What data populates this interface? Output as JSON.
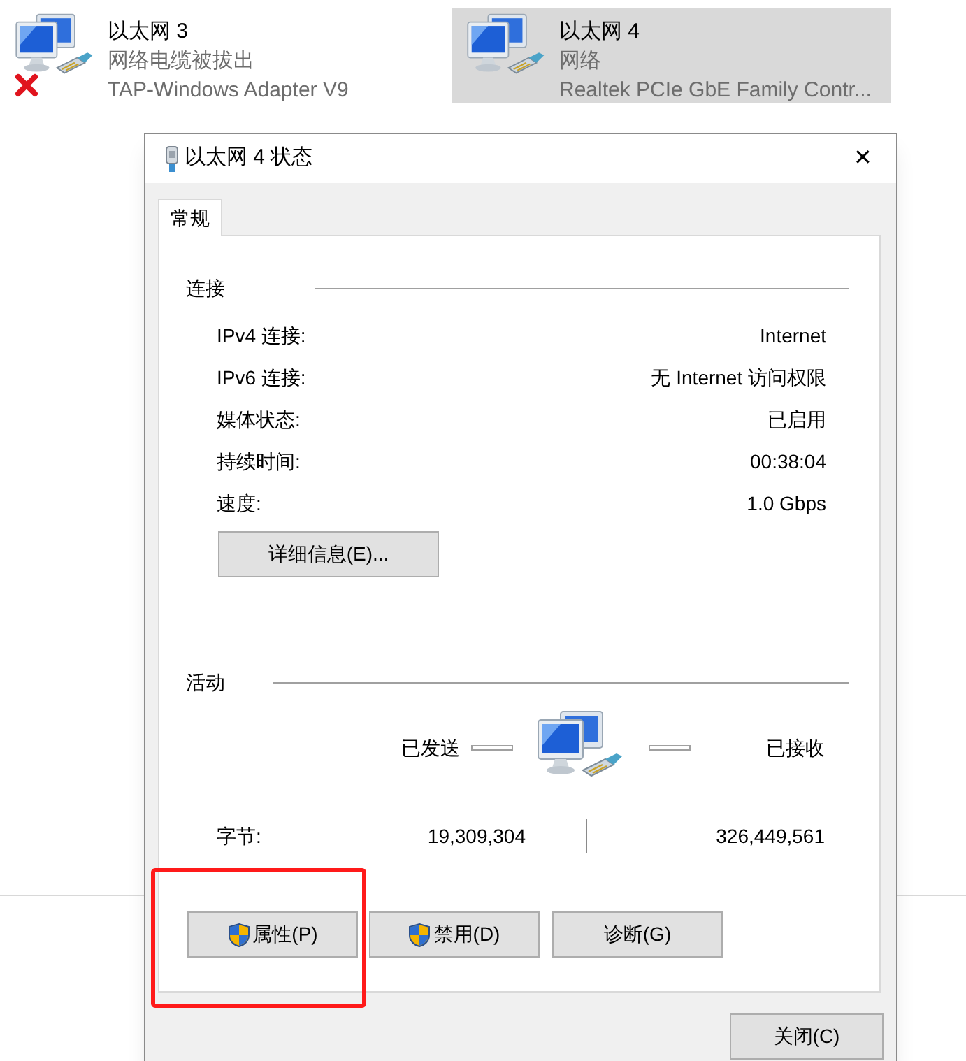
{
  "adapters": [
    {
      "name": "以太网 3",
      "status": "网络电缆被拔出",
      "device": "TAP-Windows Adapter V9",
      "disconnected": true,
      "selected": false
    },
    {
      "name": "以太网 4",
      "status": "网络",
      "device": "Realtek PCIe GbE Family Contr...",
      "disconnected": false,
      "selected": true
    }
  ],
  "dialog": {
    "title": "以太网 4 状态",
    "close_glyph": "✕",
    "tabs": [
      {
        "label": "常规",
        "selected": true
      }
    ],
    "connection": {
      "heading": "连接",
      "rows": [
        {
          "label": "IPv4 连接:",
          "value": "Internet"
        },
        {
          "label": "IPv6 连接:",
          "value": "无 Internet 访问权限"
        },
        {
          "label": "媒体状态:",
          "value": "已启用"
        },
        {
          "label": "持续时间:",
          "value": "00:38:04"
        },
        {
          "label": "速度:",
          "value": "1.0 Gbps"
        }
      ],
      "details_button": "详细信息(E)..."
    },
    "activity": {
      "heading": "活动",
      "sent_label": "已发送",
      "received_label": "已接收",
      "bytes_label": "字节:",
      "bytes_sent": "19,309,304",
      "bytes_received": "326,449,561"
    },
    "action_buttons": [
      {
        "label": "属性(P)",
        "shield": true,
        "highlighted": true
      },
      {
        "label": "禁用(D)",
        "shield": true,
        "highlighted": false
      },
      {
        "label": "诊断(G)",
        "shield": false,
        "highlighted": false
      }
    ],
    "close_button": "关闭(C)"
  }
}
